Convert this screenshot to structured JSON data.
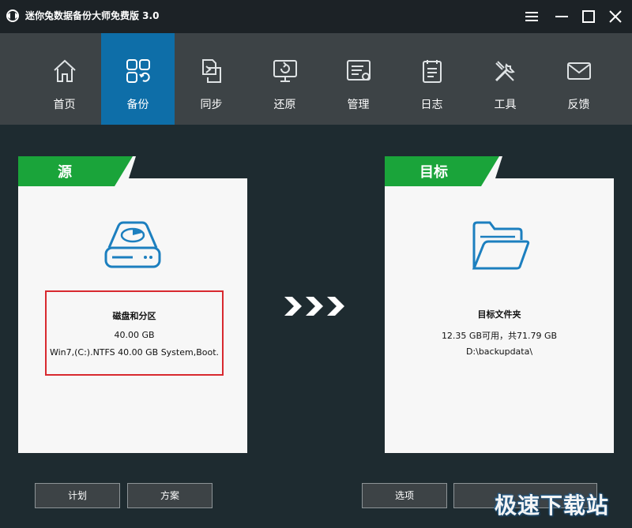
{
  "window": {
    "title": "迷你兔数据备份大师免费版 3.0",
    "colors": {
      "titlebar": "#1c2226",
      "nav": "#3d4346",
      "active": "#0e6ea8",
      "accent_green": "#1aa43a",
      "highlight_red": "#d8292f",
      "background": "#1e2b30"
    }
  },
  "nav": {
    "items": [
      {
        "label": "首页",
        "icon": "home-icon"
      },
      {
        "label": "备份",
        "icon": "backup-grid-icon",
        "active": true
      },
      {
        "label": "同步",
        "icon": "sync-icon"
      },
      {
        "label": "还原",
        "icon": "restore-icon"
      },
      {
        "label": "管理",
        "icon": "manage-icon"
      },
      {
        "label": "日志",
        "icon": "log-icon"
      },
      {
        "label": "工具",
        "icon": "tools-icon"
      },
      {
        "label": "反馈",
        "icon": "feedback-icon"
      }
    ]
  },
  "source": {
    "header": "源",
    "icon": "disk-drive-icon",
    "title": "磁盘和分区",
    "size": "40.00 GB",
    "detail": "Win7,(C:).NTFS 40.00 GB System,Boot."
  },
  "destination": {
    "header": "目标",
    "icon": "folder-icon",
    "title": "目标文件夹",
    "space": "12.35 GB可用，共71.79 GB",
    "path": "D:\\backupdata\\"
  },
  "buttons": {
    "schedule": "计划",
    "scheme": "方案",
    "options": "选项",
    "backup_now": ""
  },
  "watermark": "极速下载站"
}
